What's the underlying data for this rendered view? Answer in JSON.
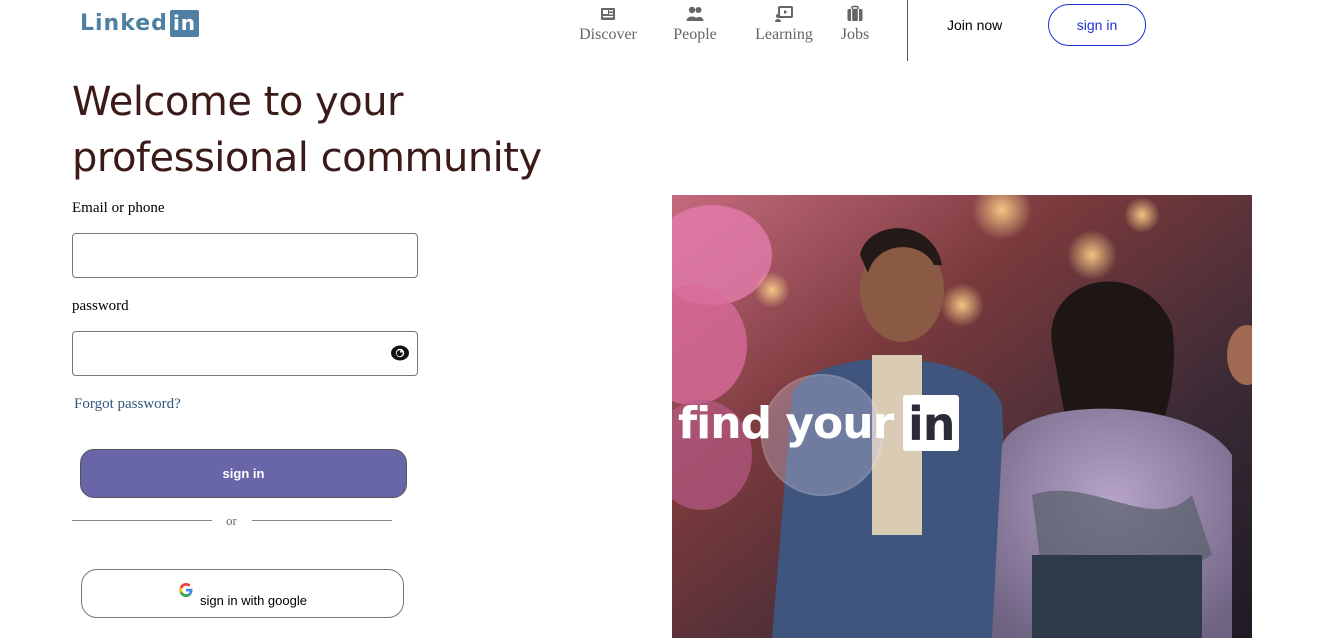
{
  "logo": {
    "text": "Linked",
    "badge": "in"
  },
  "nav": {
    "items": [
      {
        "label": "Discover",
        "icon": "newspaper-icon"
      },
      {
        "label": "People",
        "icon": "people-icon"
      },
      {
        "label": "Learning",
        "icon": "learning-icon"
      },
      {
        "label": "Jobs",
        "icon": "briefcase-icon"
      }
    ],
    "join_label": "Join now",
    "signin_label": "sign in"
  },
  "headline": {
    "line1": "Welcome to your",
    "line2": "professional community"
  },
  "form": {
    "email_label": "Email or phone",
    "email_value": "",
    "password_label": "password",
    "password_value": "",
    "forgot_label": "Forgot password?",
    "signin_label": "sign in",
    "or_label": "or",
    "google_label": "sign in with google"
  },
  "hero": {
    "text": "find your",
    "badge": "in"
  },
  "colors": {
    "brand": "#4f7fa3",
    "primary_button": "#6866a8",
    "headline": "#3b1a1a",
    "outline_accent": "#1f30d4"
  }
}
